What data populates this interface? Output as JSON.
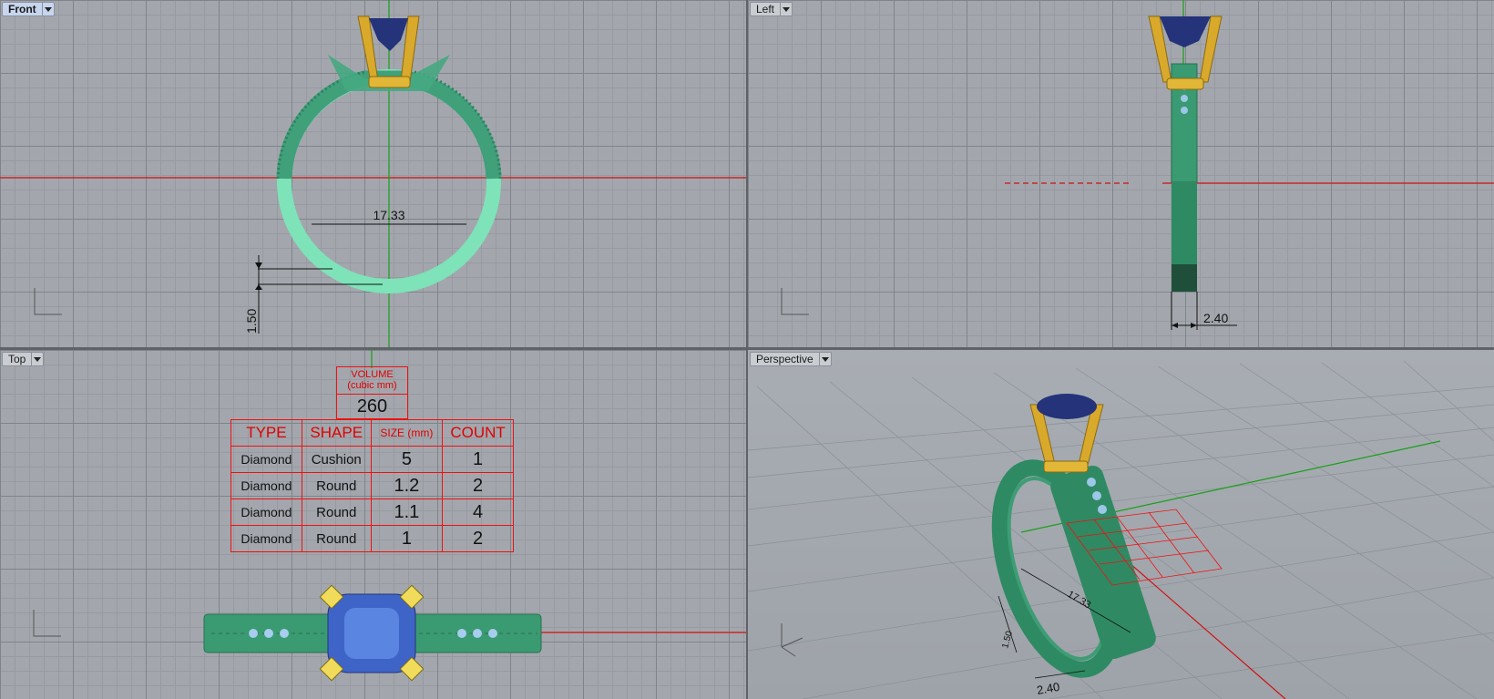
{
  "viewports": {
    "front": {
      "title": "Front",
      "active": true
    },
    "left": {
      "title": "Left"
    },
    "top": {
      "title": "Top"
    },
    "perspective": {
      "title": "Perspective"
    }
  },
  "dimensions": {
    "inner_diameter": "17.33",
    "band_thickness": "1.50",
    "band_width": "2.40"
  },
  "volume": {
    "label": "VOLUME",
    "unit": "(cubic mm)",
    "value": "260"
  },
  "stone_table": {
    "headers": [
      "TYPE",
      "SHAPE",
      "SIZE (mm)",
      "COUNT"
    ],
    "rows": [
      [
        "Diamond",
        "Cushion",
        "5",
        "1"
      ],
      [
        "Diamond",
        "Round",
        "1.2",
        "2"
      ],
      [
        "Diamond",
        "Round",
        "1.1",
        "4"
      ],
      [
        "Diamond",
        "Round",
        "1",
        "2"
      ]
    ]
  },
  "colors": {
    "band_green": "#3f8f6b",
    "band_light": "#7ee3b8",
    "prong_gold": "#d4a52a",
    "stone_blue": "#2a3f8a",
    "axis_red": "#d01010",
    "axis_green": "#18a018"
  }
}
